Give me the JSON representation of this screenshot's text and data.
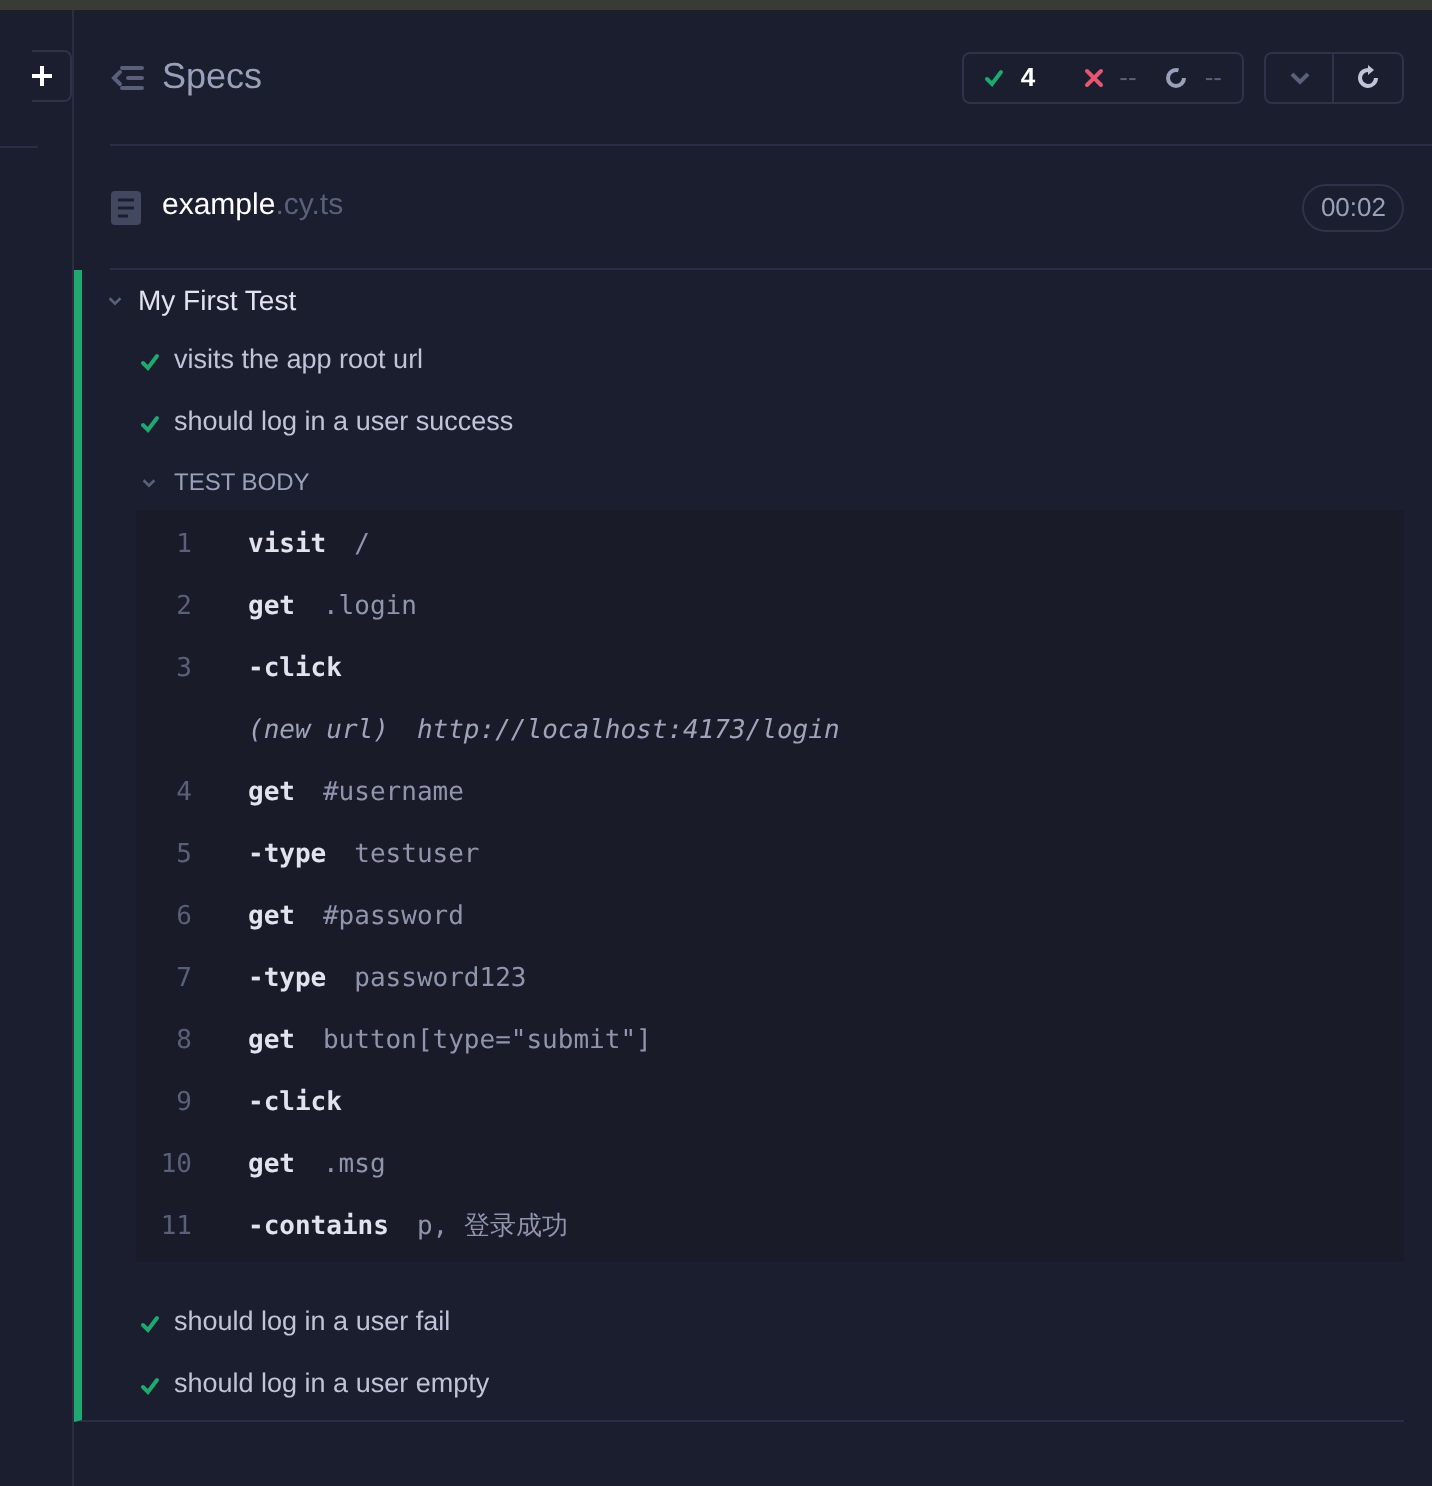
{
  "header": {
    "title": "Specs",
    "stats": {
      "passed": "4",
      "failed": "--",
      "pending": "--"
    }
  },
  "spec": {
    "name": "example",
    "extension": ".cy.ts",
    "duration": "00:02"
  },
  "suite": {
    "title": "My First Test",
    "expanded": true,
    "tests": [
      {
        "title": "visits the app root url",
        "passed": true
      },
      {
        "title": "should log in a user success",
        "passed": true,
        "body": {
          "label": "TEST BODY",
          "expanded": true,
          "commands": [
            {
              "kind": "command",
              "number": "1",
              "name": "visit",
              "arg": "/"
            },
            {
              "kind": "command",
              "number": "2",
              "name": "get",
              "arg": ".login"
            },
            {
              "kind": "child",
              "number": "3",
              "name": "-click"
            },
            {
              "kind": "event",
              "name": "(new url)",
              "arg": "http://localhost:4173/login"
            },
            {
              "kind": "command",
              "number": "4",
              "name": "get",
              "arg": "#username"
            },
            {
              "kind": "child",
              "number": "5",
              "name": "-type",
              "arg": "testuser"
            },
            {
              "kind": "command",
              "number": "6",
              "name": "get",
              "arg": "#password"
            },
            {
              "kind": "child",
              "number": "7",
              "name": "-type",
              "arg": "password123"
            },
            {
              "kind": "command",
              "number": "8",
              "name": "get",
              "arg": "button[type=\"submit\"]"
            },
            {
              "kind": "child",
              "number": "9",
              "name": "-click"
            },
            {
              "kind": "command",
              "number": "10",
              "name": "get",
              "arg": ".msg"
            },
            {
              "kind": "child",
              "number": "11",
              "name": "-contains",
              "arg": "p, 登录成功"
            }
          ]
        }
      },
      {
        "title": "should log in a user fail",
        "passed": true
      },
      {
        "title": "should log in a user empty",
        "passed": true
      }
    ]
  }
}
